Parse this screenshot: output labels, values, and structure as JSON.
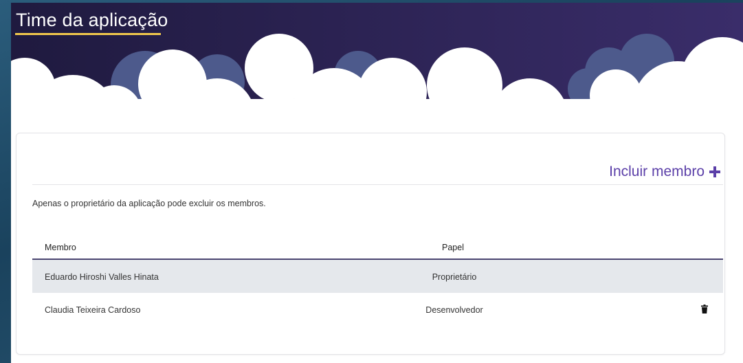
{
  "page": {
    "title": "Time da aplicação"
  },
  "card": {
    "add_member_label": "Incluir membro",
    "add_member_icon": "plus-icon",
    "notice": "Apenas o proprietário da aplicação pode excluir os membros."
  },
  "table": {
    "columns": [
      "Membro",
      "Papel"
    ],
    "rows": [
      {
        "member": "Eduardo Hiroshi Valles Hinata",
        "role": "Proprietário",
        "deletable": false
      },
      {
        "member": "Claudia Teixeira Cardoso",
        "role": "Desenvolvedor",
        "deletable": true,
        "action_icon": "trash-icon"
      }
    ]
  },
  "colors": {
    "header_dark": "#1f1a3f",
    "header_light": "#3a2d6a",
    "accent_purple": "#5b3fa8",
    "title_underline": "#f2c94c",
    "cloud_back": "#4d5a8c",
    "row_shade": "#e5e8ec"
  }
}
